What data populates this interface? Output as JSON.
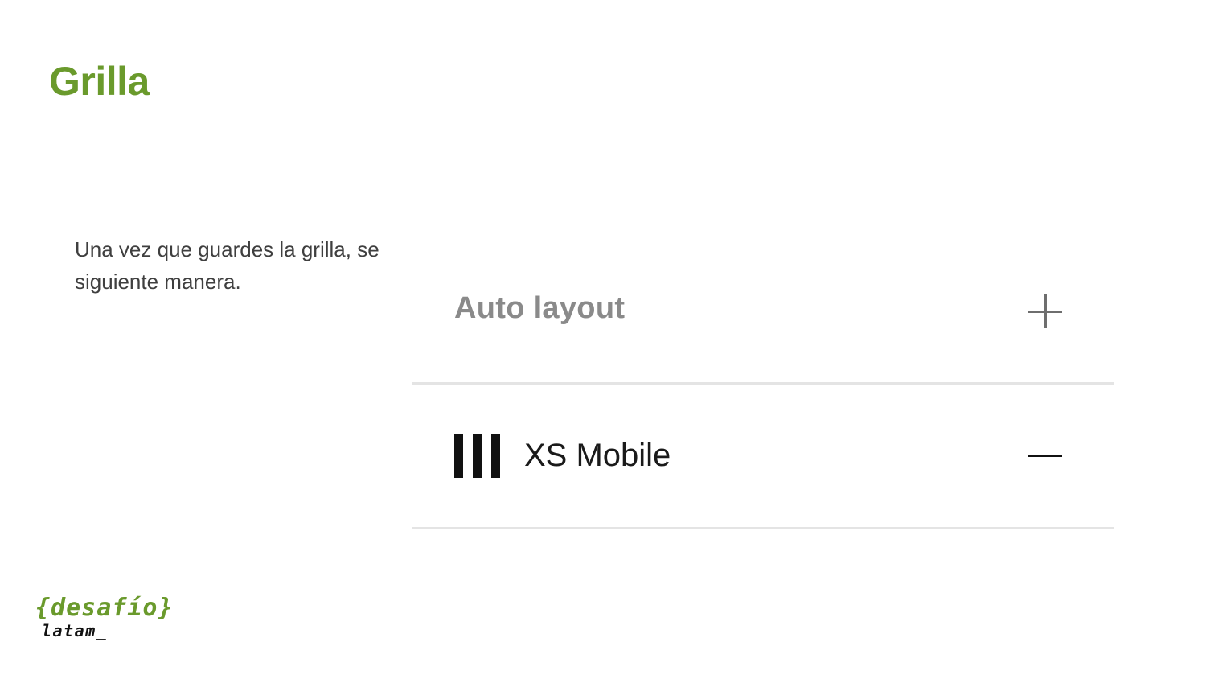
{
  "slide": {
    "title": "Grilla",
    "body": "Una vez que guardes la grilla, se siguiente manera."
  },
  "panel": {
    "auto_layout_label": "Auto layout",
    "add_icon": "plus-icon",
    "grid_label": "XS Mobile",
    "grid_icon": "columns-icon",
    "remove_icon": "minus-icon"
  },
  "logo": {
    "top": "{desafío}",
    "bottom": "latam_"
  },
  "colors": {
    "accent": "#6a9a2c",
    "text": "#3f3f3f",
    "divider": "#e4e4e4"
  }
}
